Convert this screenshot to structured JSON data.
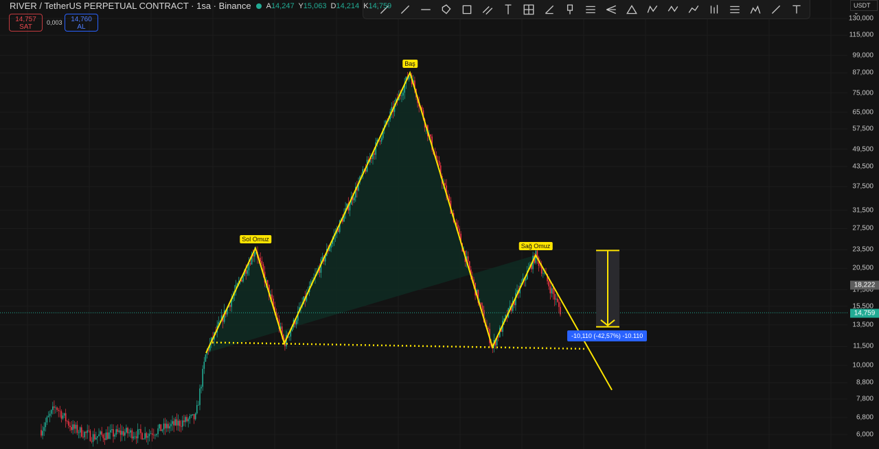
{
  "header": {
    "symbol": "RIVER / TetherUS PERPETUAL CONTRACT · 1sa · Binance",
    "ohlc": [
      {
        "k": "A",
        "v": "14,247"
      },
      {
        "k": "Y",
        "v": "15,063"
      },
      {
        "k": "D",
        "v": "14,214"
      },
      {
        "k": "K",
        "v": "14,759"
      }
    ]
  },
  "quote": {
    "sell_price": "14,757",
    "sell_label": "SAT",
    "spread": "0,003",
    "buy_price": "14,760",
    "buy_label": "AL"
  },
  "toolbar": {
    "icons": [
      "trend-line-icon",
      "ray-icon",
      "horizontal-ray-icon",
      "rotated-rect-icon",
      "rectangle-icon",
      "parallel-channel-icon",
      "vertical-line-icon",
      "crosshair-grid-icon",
      "fib-icon",
      "price-label-icon",
      "horizontal-lines-icon",
      "pitchfork-icon",
      "triangle-icon",
      "xabcd-icon",
      "elliott-wave-icon",
      "polyline-icon",
      "candles-icon",
      "lines-icon",
      "head-shoulders-icon",
      "brush-icon",
      "text-icon"
    ]
  },
  "axis": {
    "currency": "USDT",
    "last_price": "14,759",
    "marker_price": "18,222"
  },
  "colors": {
    "up": "#22ab94",
    "down": "#f23645",
    "pattern": "#ffe500",
    "fill": "#0f2a22",
    "measure_label": "#2962ff"
  },
  "chart_data": {
    "type": "candlestick",
    "scale": "log",
    "ylim": [
      5800,
      135000
    ],
    "y_ticks": [
      "130,000",
      "115,000",
      "99,000",
      "87,000",
      "75,000",
      "65,000",
      "57,500",
      "49,500",
      "43,500",
      "37,500",
      "31,500",
      "27,500",
      "23,500",
      "20,500",
      "17,500",
      "15,500",
      "13,500",
      "11,500",
      "10,000",
      "8,800",
      "7,800",
      "6,800",
      "6,000"
    ],
    "last_price": 14759,
    "pattern": {
      "type": "head-and-shoulders",
      "points": [
        {
          "bar": 100,
          "price": 10960
        },
        {
          "bar": 124,
          "price": 23800
        },
        {
          "bar": 138,
          "price": 11770
        },
        {
          "bar": 199,
          "price": 87100
        },
        {
          "bar": 239,
          "price": 11460
        },
        {
          "bar": 260,
          "price": 22600
        },
        {
          "bar": 297,
          "price": 8340
        }
      ],
      "labels": [
        {
          "text": "Sol Omuz",
          "bar": 124,
          "price": 23800
        },
        {
          "text": "Baş",
          "bar": 199,
          "price": 87100
        },
        {
          "text": "Sağ Omuz",
          "bar": 260,
          "price": 22600
        }
      ],
      "neckline": [
        {
          "bar": 103,
          "price": 11850
        },
        {
          "bar": 285,
          "price": 11300
        }
      ]
    },
    "measure": {
      "bar": 295,
      "from": 23400,
      "to": 13300,
      "label": "-10,110 (-42,57%) -10.110"
    }
  }
}
